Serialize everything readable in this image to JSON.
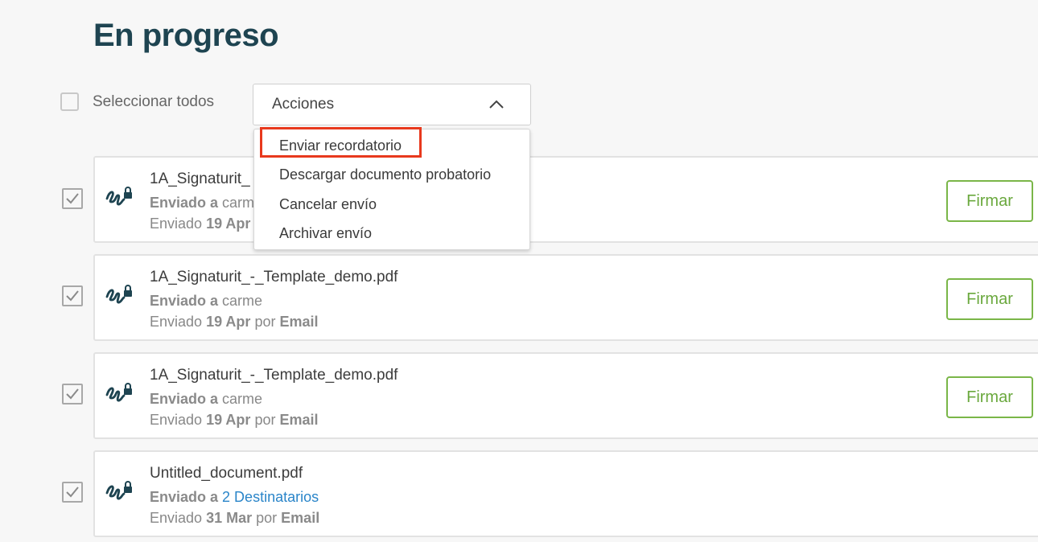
{
  "page": {
    "title": "En progreso"
  },
  "toolbar": {
    "select_all_label": "Seleccionar todos",
    "actions_label": "Acciones",
    "menu": [
      {
        "label": "Enviar recordatorio",
        "highlighted": true
      },
      {
        "label": "Descargar documento probatorio"
      },
      {
        "label": "Cancelar envío"
      },
      {
        "label": "Archivar envío"
      }
    ]
  },
  "colors": {
    "title": "#1e4451",
    "accent_green": "#7ab648",
    "link_blue": "#2a85c9",
    "highlight_red": "#e8391d"
  },
  "documents": [
    {
      "name": "1A_Signaturit_",
      "sent_to_prefix": "Enviado a",
      "recipient": "carm",
      "sent_prefix": "Enviado",
      "date": "19 Apr",
      "method_prefix": "",
      "method": "",
      "sign_label": "Firmar",
      "checked": true
    },
    {
      "name": "1A_Signaturit_-_Template_demo.pdf",
      "sent_to_prefix": "Enviado a",
      "recipient": "carme",
      "sent_prefix": "Enviado",
      "date": "19 Apr",
      "method_prefix": "por",
      "method": "Email",
      "sign_label": "Firmar",
      "checked": true
    },
    {
      "name": "1A_Signaturit_-_Template_demo.pdf",
      "sent_to_prefix": "Enviado a",
      "recipient": "carme",
      "sent_prefix": "Enviado",
      "date": "19 Apr",
      "method_prefix": "por",
      "method": "Email",
      "sign_label": "Firmar",
      "checked": true
    },
    {
      "name": "Untitled_document.pdf",
      "sent_to_prefix": "Enviado a",
      "recipient": "2 Destinatarios",
      "sent_prefix": "Enviado",
      "date": "31 Mar",
      "method_prefix": "por",
      "method": "Email",
      "checked": true
    }
  ]
}
